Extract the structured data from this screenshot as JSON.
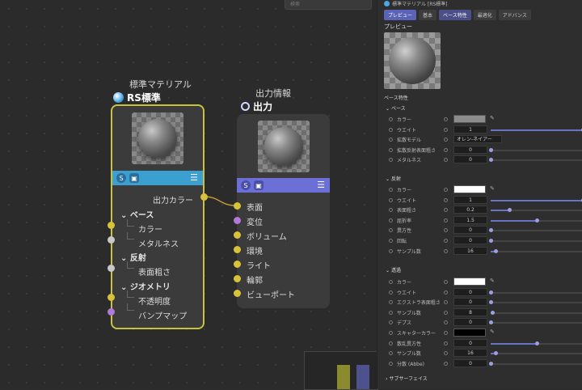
{
  "search": {
    "placeholder": "検索"
  },
  "node1": {
    "title": "標準マテリアル",
    "subtitle": "RS標準",
    "output_label": "出力カラー",
    "sections": [
      {
        "label": "ベース",
        "items": [
          "カラー",
          "メタルネス"
        ]
      },
      {
        "label": "反射",
        "items": [
          "表面粗さ"
        ]
      },
      {
        "label": "ジオメトリ",
        "items": [
          "不透明度",
          "バンプマップ"
        ]
      }
    ]
  },
  "node2": {
    "title": "出力情報",
    "subtitle": "出力",
    "inputs": [
      "表面",
      "変位",
      "ボリューム",
      "環境",
      "ライト",
      "輪郭",
      "ビューポート"
    ]
  },
  "colors": {
    "node1_bar": "#3b9fd0",
    "node2_bar": "#6b6fd6",
    "selection": "#c9c23c",
    "port_yellow": "#d8c23a",
    "port_purple": "#b07ad8",
    "accent": "#5a63b8"
  },
  "panel": {
    "title": "標準マテリアル [RS標準]",
    "tabs": [
      "プレビュー",
      "基本",
      "ベース特性",
      "最適化",
      "アドバンス"
    ],
    "active_tab": "ベース特性",
    "preview_label": "プレビュー",
    "section_label": "ベース特性",
    "base": {
      "label": "ベース",
      "rows": [
        {
          "label": "カラー",
          "swatch": "#8c8c8c"
        },
        {
          "label": "ウエイト",
          "value": "1",
          "slider": 1.0
        },
        {
          "label": "拡散モデル",
          "value": "オレン-ネイアー"
        },
        {
          "label": "拡散反射表面粗さ",
          "value": "0",
          "slider": 0
        },
        {
          "label": "メタルネス",
          "value": "0",
          "slider": 0
        }
      ]
    },
    "reflection": {
      "label": "反射",
      "rows": [
        {
          "label": "カラー",
          "swatch": "#ffffff"
        },
        {
          "label": "ウエイト",
          "value": "1",
          "slider": 1.0
        },
        {
          "label": "表面粗さ",
          "value": "0.2",
          "slider": 0.2
        },
        {
          "label": "屈折率",
          "value": "1.5",
          "slider": 0.5
        },
        {
          "label": "異方性",
          "value": "0",
          "slider": 0
        },
        {
          "label": "回転",
          "value": "0",
          "slider": 0
        },
        {
          "label": "サンプル数",
          "value": "16",
          "slider": 0.05
        }
      ]
    },
    "transmission": {
      "label": "透過",
      "rows": [
        {
          "label": "カラー",
          "swatch": "#ffffff"
        },
        {
          "label": "ウエイト",
          "value": "0",
          "slider": 0
        },
        {
          "label": "エクストラ表面粗さ",
          "value": "0",
          "slider": 0
        },
        {
          "label": "サンプル数",
          "value": "8",
          "slider": 0.02
        },
        {
          "label": "デプス",
          "value": "0",
          "slider": 0
        },
        {
          "label": "スキャターカラー",
          "swatch": "#000000"
        },
        {
          "label": "散乱異方性",
          "value": "0",
          "slider": 0.5
        },
        {
          "label": "サンプル数",
          "value": "16",
          "slider": 0.05
        },
        {
          "label": "分散 (Abbe)",
          "value": "0",
          "slider": 0
        }
      ]
    },
    "footer_group": "サブサーフェイス"
  }
}
